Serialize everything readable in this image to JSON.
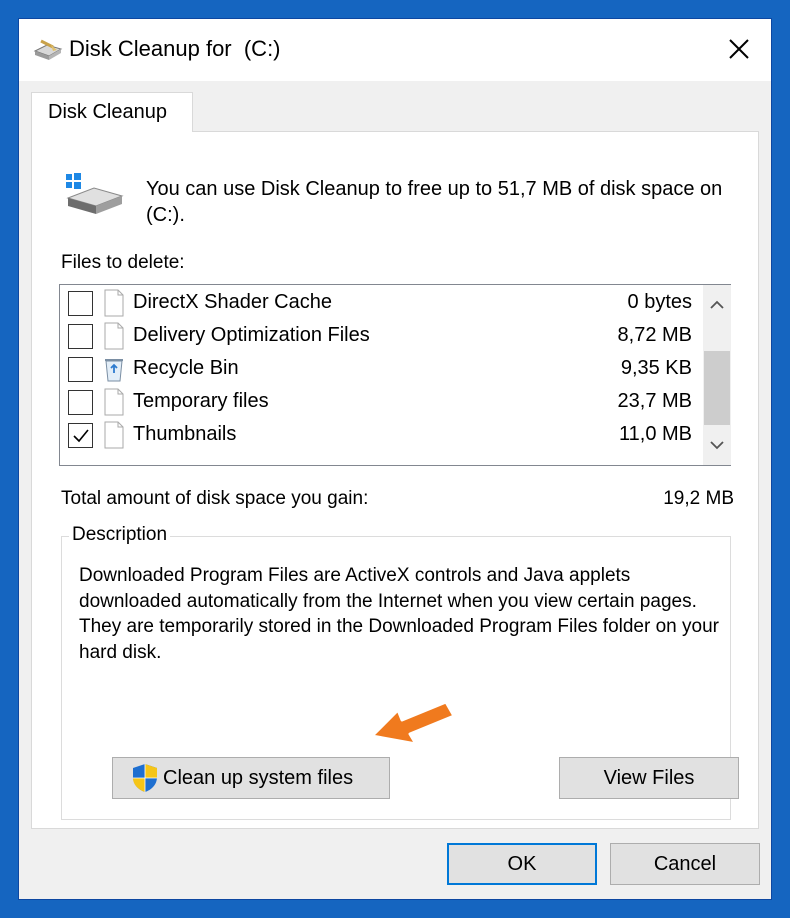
{
  "window": {
    "title": "Disk Cleanup for  (C:)",
    "close_glyph": "✕"
  },
  "tab": {
    "label": "Disk Cleanup"
  },
  "intro": {
    "text": "You can use Disk Cleanup to free up to 51,7 MB of disk space on  (C:)."
  },
  "files": {
    "label": "Files to delete:",
    "items": [
      {
        "name": "DirectX Shader Cache",
        "size": "0 bytes",
        "checked": false,
        "icon": "file-icon"
      },
      {
        "name": "Delivery Optimization Files",
        "size": "8,72 MB",
        "checked": false,
        "icon": "file-icon"
      },
      {
        "name": "Recycle Bin",
        "size": "9,35 KB",
        "checked": false,
        "icon": "recycle-bin-icon"
      },
      {
        "name": "Temporary files",
        "size": "23,7 MB",
        "checked": false,
        "icon": "file-icon"
      },
      {
        "name": "Thumbnails",
        "size": "11,0 MB",
        "checked": true,
        "icon": "file-icon"
      }
    ],
    "check_glyph": "✓"
  },
  "total": {
    "label": "Total amount of disk space you gain:",
    "value": "19,2 MB"
  },
  "description": {
    "title": "Description",
    "text": "Downloaded Program Files are ActiveX controls and Java applets downloaded automatically from the Internet when you view certain pages. They are temporarily stored in the Downloaded Program Files folder on your hard disk."
  },
  "buttons": {
    "cleanup_system": "Clean up system files",
    "view_files": "View Files",
    "ok": "OK",
    "cancel": "Cancel"
  },
  "colors": {
    "desktop": "#1565c0",
    "accent": "#0078d7",
    "arrow": "#f07a1e"
  }
}
